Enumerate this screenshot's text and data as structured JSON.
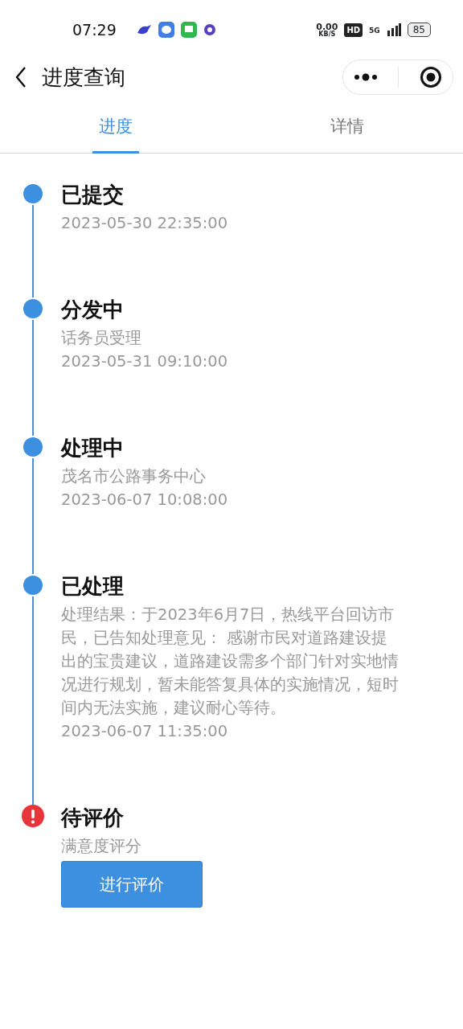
{
  "status_bar": {
    "time": "07:29",
    "net_speed": "0.00",
    "net_unit": "KB/S",
    "hd": "HD",
    "network": "5G",
    "battery": "85"
  },
  "header": {
    "title": "进度查询"
  },
  "tabs": [
    {
      "label": "进度",
      "selected": true
    },
    {
      "label": "详情",
      "selected": false
    }
  ],
  "steps": [
    {
      "kind": "done",
      "title": "已提交",
      "lines": [
        "2023-05-30 22:35:00"
      ]
    },
    {
      "kind": "done",
      "title": "分发中",
      "lines": [
        "话务员受理",
        "2023-05-31 09:10:00"
      ]
    },
    {
      "kind": "done",
      "title": "处理中",
      "lines": [
        "茂名市公路事务中心",
        "2023-06-07 10:08:00"
      ]
    },
    {
      "kind": "done",
      "title": "已处理",
      "lines": [
        "处理结果：于2023年6月7日，热线平台回访市民，已告知处理意见： 感谢市民对道路建设提出的宝贵建议，道路建设需多个部门针对实地情况进行规划，暂未能答复具体的实施情况，短时间内无法实施，建议耐心等待。",
        "2023-06-07 11:35:00"
      ]
    },
    {
      "kind": "pending",
      "title": "待评价",
      "lines": [
        "满意度评分"
      ],
      "button": "进行评价"
    }
  ]
}
